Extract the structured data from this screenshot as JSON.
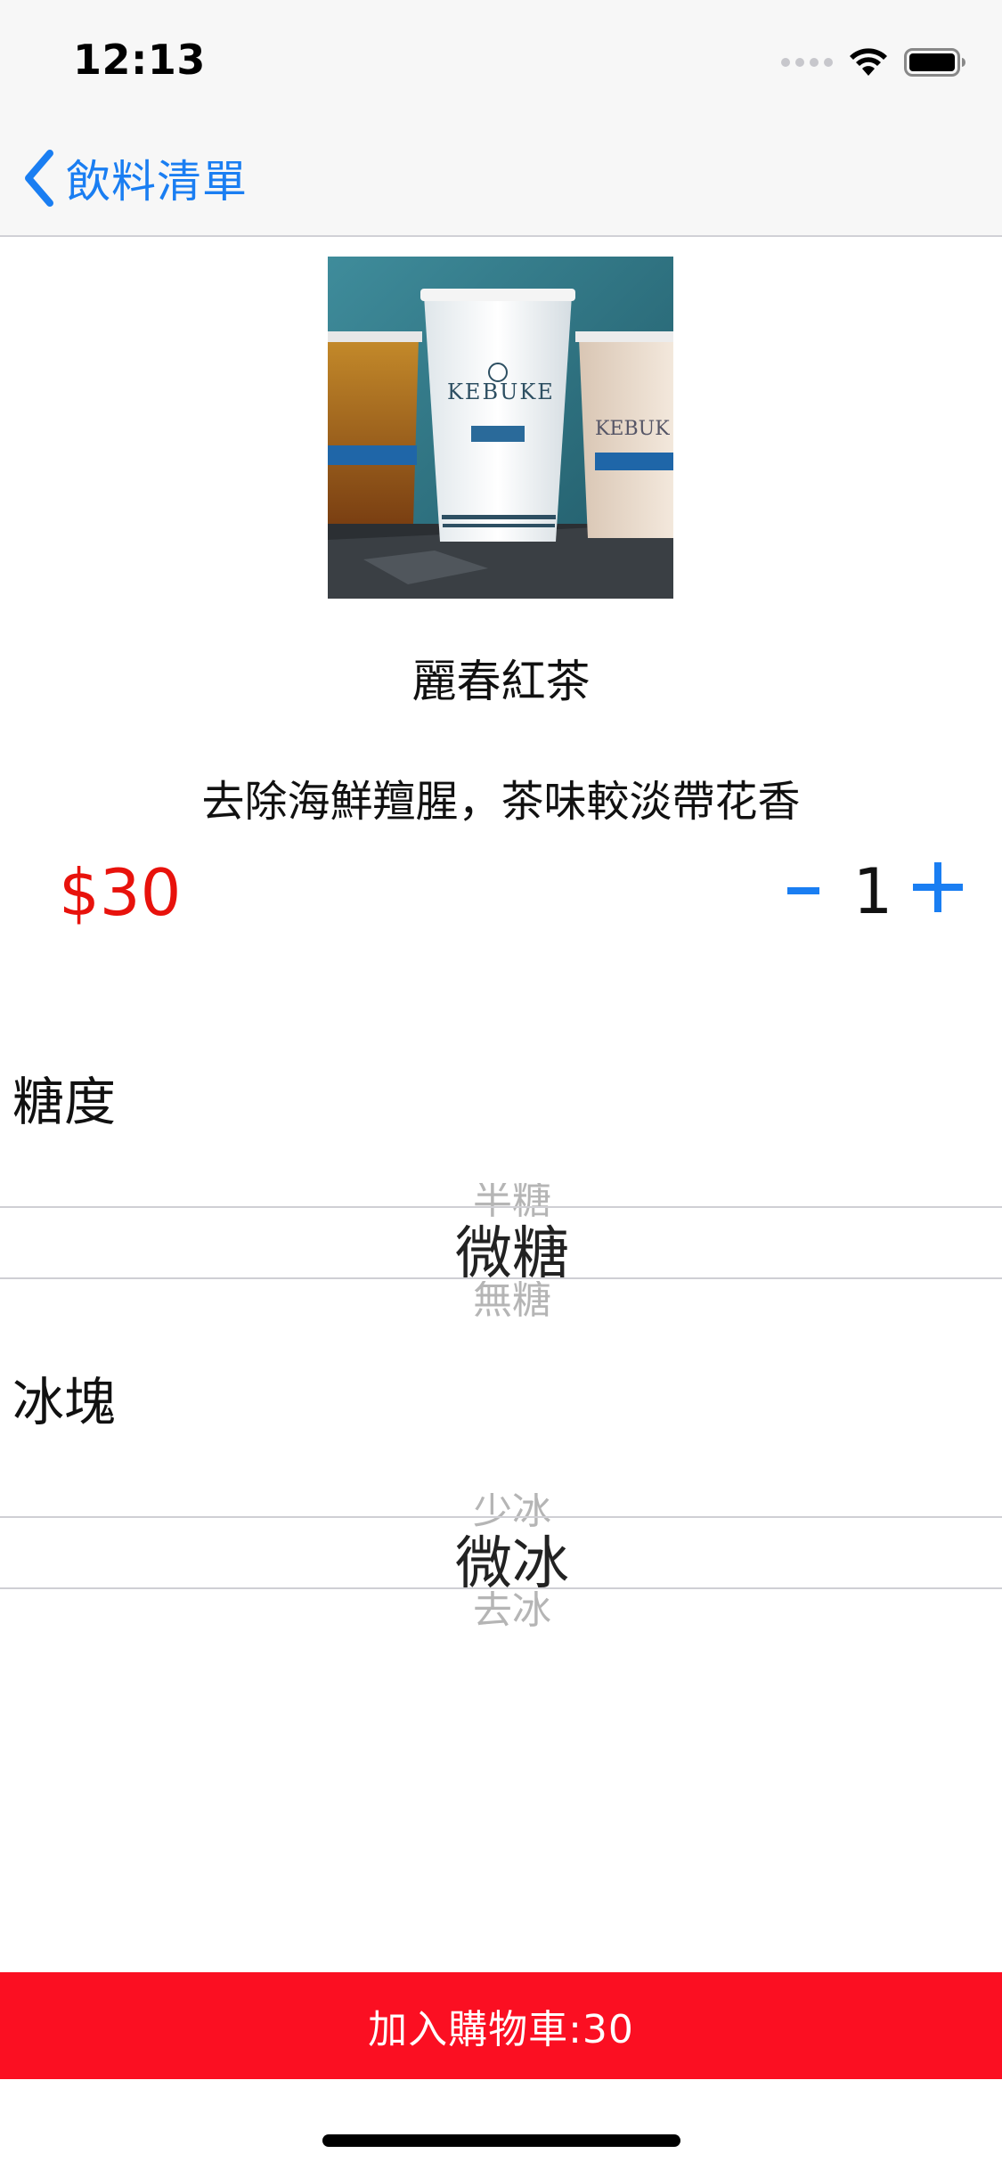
{
  "status_bar": {
    "time": "12:13"
  },
  "nav": {
    "back_label": "飲料清單"
  },
  "product": {
    "name": "麗春紅茶",
    "description": "去除海鮮羶腥，茶味較淡帶花香",
    "price": "$30",
    "quantity": "1",
    "image_brand": "KEBUKE"
  },
  "sugar": {
    "label": "糖度",
    "above": "半糖",
    "selected": "微糖",
    "below": "無糖"
  },
  "ice": {
    "label": "冰塊",
    "above": "少冰",
    "selected": "微冰",
    "below": "去冰"
  },
  "cart": {
    "button_label": "加入購物車:30"
  },
  "colors": {
    "accent": "#1a7ef2",
    "price": "#e8120c",
    "cart_button": "#fb0f22"
  },
  "icons": [
    "chevron-left-icon",
    "signal-icon",
    "wifi-icon",
    "battery-icon"
  ]
}
